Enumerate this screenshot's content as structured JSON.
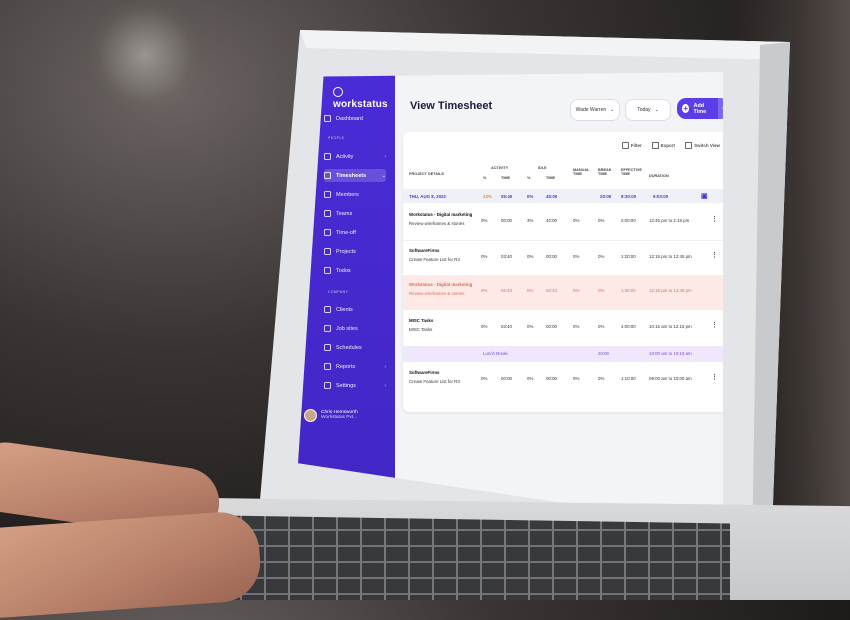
{
  "app": {
    "logo": "workstatus"
  },
  "sidebar": {
    "section_people": "PEOPLE",
    "section_company": "COMPANY",
    "items": [
      {
        "label": "Dashboard"
      },
      {
        "label": "Activity"
      },
      {
        "label": "Timesheets"
      },
      {
        "label": "Members"
      },
      {
        "label": "Teams"
      },
      {
        "label": "Time-off"
      },
      {
        "label": "Projects"
      },
      {
        "label": "Todos"
      },
      {
        "label": "Clients"
      },
      {
        "label": "Job sites"
      },
      {
        "label": "Schedules"
      },
      {
        "label": "Reports"
      },
      {
        "label": "Settings"
      }
    ],
    "user": {
      "name": "Chris Hemsworth",
      "org": "Workstatus Pvt..."
    }
  },
  "header": {
    "title": "View Timesheet",
    "member_select": "Wade Warren",
    "date_select": "Today",
    "add_time": "Add Time"
  },
  "toolbar": {
    "filter": "Filter",
    "export": "Export",
    "switch_view": "Switch View"
  },
  "table": {
    "headers": {
      "project": "PROJECT DETAILS",
      "activity": "ACTIVITY",
      "idle": "IDLE",
      "pct": "%",
      "time": "TIME",
      "manual_time": "MANUAL TIME",
      "break_time": "BREAK TIME",
      "effective_time": "EFFECTIVE TIME",
      "duration": "DURATION"
    },
    "date_row": {
      "date": "THU, AUG 8, 2022",
      "act_pct": "43%",
      "act_time": "05:40",
      "idle_pct": "0%",
      "idle_time": "45:00",
      "break": "20:00",
      "effective": "8:30:00",
      "duration": "9:03:00"
    },
    "rows": [
      {
        "project": "Workstatus - Digital marketing",
        "task": "Review wireframes & stories",
        "act_pct": "0%",
        "act_time": "00:00",
        "idle_pct": "3%",
        "idle_time": "40:00",
        "manual": "0%",
        "break": "0%",
        "effective": "2:00:00",
        "duration": "12:45 pm to 2:15 pm"
      },
      {
        "project": "SoftwareFirms",
        "task": "Create Feature List for R3",
        "act_pct": "0%",
        "act_time": "03:40",
        "idle_pct": "0%",
        "idle_time": "00:00",
        "manual": "0%",
        "break": "0%",
        "effective": "1:20:00",
        "duration": "12:15 pm to 12:45 pm"
      },
      {
        "project": "Workstatus - Digital marketing",
        "task": "Review wireframes & stories",
        "act_pct": "0%",
        "act_time": "02:43",
        "idle_pct": "0%",
        "idle_time": "02:43",
        "manual": "0%",
        "break": "0%",
        "effective": "1:30:00",
        "duration": "12:15 pm to 12:45 pm"
      },
      {
        "project": "MISC Tasks",
        "task": "MISC Tasks",
        "act_pct": "0%",
        "act_time": "03:40",
        "idle_pct": "0%",
        "idle_time": "00:00",
        "manual": "0%",
        "break": "0%",
        "effective": "4:00:00",
        "duration": "10:15 am to 12:15 pm"
      },
      {
        "project": "SoftwareFirms",
        "task": "Create Feature List for R3",
        "act_pct": "0%",
        "act_time": "00:00",
        "idle_pct": "0%",
        "idle_time": "00:00",
        "manual": "0%",
        "break": "0%",
        "effective": "1:10:00",
        "duration": "09:00 am to 10:00 am"
      }
    ],
    "lunch": {
      "label": "Lunch Break",
      "break": "20:00",
      "duration": "10:00 am to 10:15 am"
    }
  },
  "colors": {
    "brand": "#4a2bd6",
    "accent": "#5b3ee8",
    "strike_row": "#fde9e6",
    "lunch_row": "#efe7fb"
  }
}
